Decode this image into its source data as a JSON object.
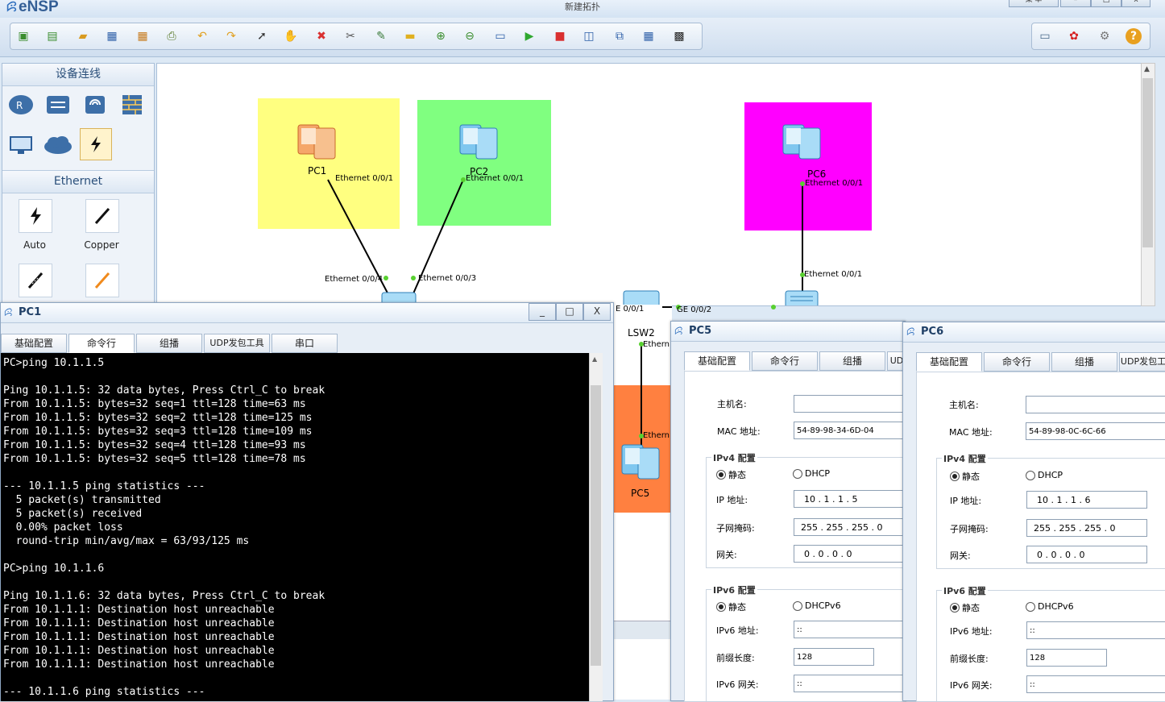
{
  "app": {
    "name": "eNSP",
    "window_title": "新建拓扑",
    "menu_label": "菜 单"
  },
  "toolbar": {
    "left_icons": [
      "new-topology-icon",
      "new-exam-icon",
      "open-icon",
      "save-icon",
      "save-as-icon",
      "print-icon",
      "undo-icon",
      "redo-icon",
      "select-icon",
      "pan-hand-icon",
      "delete-icon",
      "delete-link-icon",
      "add-note-icon",
      "palette-icon",
      "zoom-in-icon",
      "zoom-out-icon",
      "fit-view-icon",
      "start-device-icon",
      "stop-device-icon",
      "capture-icon",
      "grid-icon",
      "topology-icon",
      "screenshot-icon"
    ],
    "right_icons": [
      "feedback-icon",
      "huawei-icon",
      "settings-icon",
      "help-icon"
    ]
  },
  "left_panel": {
    "section1": {
      "title": "设备连线",
      "devices": [
        "router-icon",
        "switch-icon",
        "wlan-icon",
        "firewall-icon",
        "pc-icon",
        "cloud-icon",
        "connection-icon"
      ]
    },
    "section2": {
      "title": "Ethernet",
      "cables": [
        {
          "label": "Auto",
          "icon": "auto-cable-icon"
        },
        {
          "label": "Copper",
          "icon": "copper-cable-icon"
        },
        {
          "label": "",
          "icon": "serial-cable-icon"
        },
        {
          "label": "",
          "icon": "pos-cable-icon"
        }
      ]
    }
  },
  "topology": {
    "zones": [
      {
        "color": "#ffff80"
      },
      {
        "color": "#80ff80"
      },
      {
        "color": "#ff00ff"
      },
      {
        "color": "#ff8040"
      }
    ],
    "devices": {
      "pc1": "PC1",
      "pc2": "PC2",
      "pc6": "PC6",
      "pc5": "PC5",
      "lsw2": "LSW2"
    },
    "ports": {
      "pc1_eth": "Ethernet 0/0/1",
      "pc2_eth": "Ethernet 0/0/1",
      "pc6_eth": "Ethernet 0/0/1",
      "sw1_e4": "Ethernet 0/0/4",
      "sw1_e3": "Ethernet 0/0/3",
      "sw3_e1": "Ethernet 0/0/1",
      "lsw2_e1": "E 0/0/1",
      "lsw2_ge2": "GE 0/0/2",
      "sw3_ge2": "GE 0/0/2",
      "lsw2_eth_down": "Ethern",
      "pc5_eth": "Ethern"
    }
  },
  "pc1_window": {
    "title": "PC1",
    "tabs": [
      "基础配置",
      "命令行",
      "组播",
      "UDP发包工具",
      "串口"
    ],
    "active_tab": 1,
    "controls": {
      "minimize": "_",
      "maximize": "□",
      "close": "X"
    },
    "terminal_text": "PC>ping 10.1.1.5\n\nPing 10.1.1.5: 32 data bytes, Press Ctrl_C to break\nFrom 10.1.1.5: bytes=32 seq=1 ttl=128 time=63 ms\nFrom 10.1.1.5: bytes=32 seq=2 ttl=128 time=125 ms\nFrom 10.1.1.5: bytes=32 seq=3 ttl=128 time=109 ms\nFrom 10.1.1.5: bytes=32 seq=4 ttl=128 time=93 ms\nFrom 10.1.1.5: bytes=32 seq=5 ttl=128 time=78 ms\n\n--- 10.1.1.5 ping statistics ---\n  5 packet(s) transmitted\n  5 packet(s) received\n  0.00% packet loss\n  round-trip min/avg/max = 63/93/125 ms\n\nPC>ping 10.1.1.6\n\nPing 10.1.1.6: 32 data bytes, Press Ctrl_C to break\nFrom 10.1.1.1: Destination host unreachable\nFrom 10.1.1.1: Destination host unreachable\nFrom 10.1.1.1: Destination host unreachable\nFrom 10.1.1.1: Destination host unreachable\nFrom 10.1.1.1: Destination host unreachable\n\n--- 10.1.1.6 ping statistics ---"
  },
  "pc5_window": {
    "title": "PC5",
    "tabs": [
      "基础配置",
      "命令行",
      "组播",
      "UD"
    ],
    "labels": {
      "hostname": "主机名:",
      "mac": "MAC 地址:",
      "ipv4": "IPv4 配置",
      "static": "静态",
      "dhcp": "DHCP",
      "ip": "IP 地址:",
      "mask": "子网掩码:",
      "gw": "网关:",
      "ipv6": "IPv6 配置",
      "static6": "静态",
      "dhcp6": "DHCPv6",
      "ip6": "IPv6 地址:",
      "prefix": "前缀长度:",
      "gw6": "IPv6 网关:"
    },
    "values": {
      "hostname": "",
      "mac": "54-89-98-34-6D-04",
      "ip": "10  .  1  .  1  .  5",
      "mask": "255 . 255 . 255 .  0",
      "gw": "0  .  0  .  0  .  0",
      "ip6": "::",
      "prefix": "128",
      "gw6": "::"
    }
  },
  "pc6_window": {
    "title": "PC6",
    "tabs": [
      "基础配置",
      "命令行",
      "组播",
      "UDP发包工"
    ],
    "labels": {
      "hostname": "主机名:",
      "mac": "MAC 地址:",
      "ipv4": "IPv4 配置",
      "static": "静态",
      "dhcp": "DHCP",
      "ip": "IP 地址:",
      "mask": "子网掩码:",
      "gw": "网关:",
      "ipv6": "IPv6 配置",
      "static6": "静态",
      "dhcp6": "DHCPv6",
      "ip6": "IPv6 地址:",
      "prefix": "前缀长度:",
      "gw6": "IPv6 网关:"
    },
    "values": {
      "hostname": "",
      "mac": "54-89-98-0C-6C-66",
      "ip": "10  .  1  .  1  .  6",
      "mask": "255 . 255 . 255 .  0",
      "gw": "0  .  0  .  0  .  0",
      "ip6": "::",
      "prefix": "128",
      "gw6": "::"
    }
  }
}
